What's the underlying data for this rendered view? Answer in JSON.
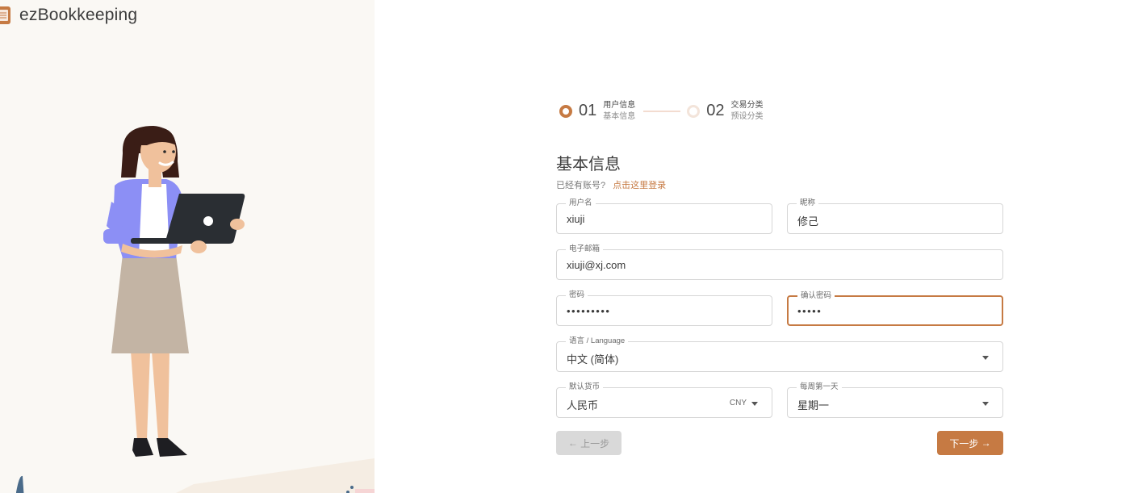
{
  "app": {
    "name": "ezBookkeeping"
  },
  "stepper": {
    "steps": [
      {
        "number": "01",
        "title": "用户信息",
        "subtitle": "基本信息"
      },
      {
        "number": "02",
        "title": "交易分类",
        "subtitle": "预设分类"
      }
    ]
  },
  "form": {
    "title": "基本信息",
    "login_prompt": "已经有账号?",
    "login_link": "点击这里登录",
    "fields": {
      "username": {
        "label": "用户名",
        "value": "xiuji"
      },
      "nickname": {
        "label": "昵称",
        "value": "修己"
      },
      "email": {
        "label": "电子邮箱",
        "value": "xiuji@xj.com"
      },
      "password": {
        "label": "密码",
        "value": "•••••••••"
      },
      "confirm_password": {
        "label": "确认密码",
        "value": "•••••"
      },
      "language": {
        "label": "语言 / Language",
        "value": "中文 (简体)"
      },
      "currency": {
        "label": "默认货币",
        "value": "人民币",
        "code": "CNY"
      },
      "first_day": {
        "label": "每周第一天",
        "value": "星期一"
      }
    }
  },
  "buttons": {
    "prev": "上一步",
    "next": "下一步"
  },
  "colors": {
    "accent": "#c67a43",
    "left_panel_bg": "#faf8f4"
  }
}
